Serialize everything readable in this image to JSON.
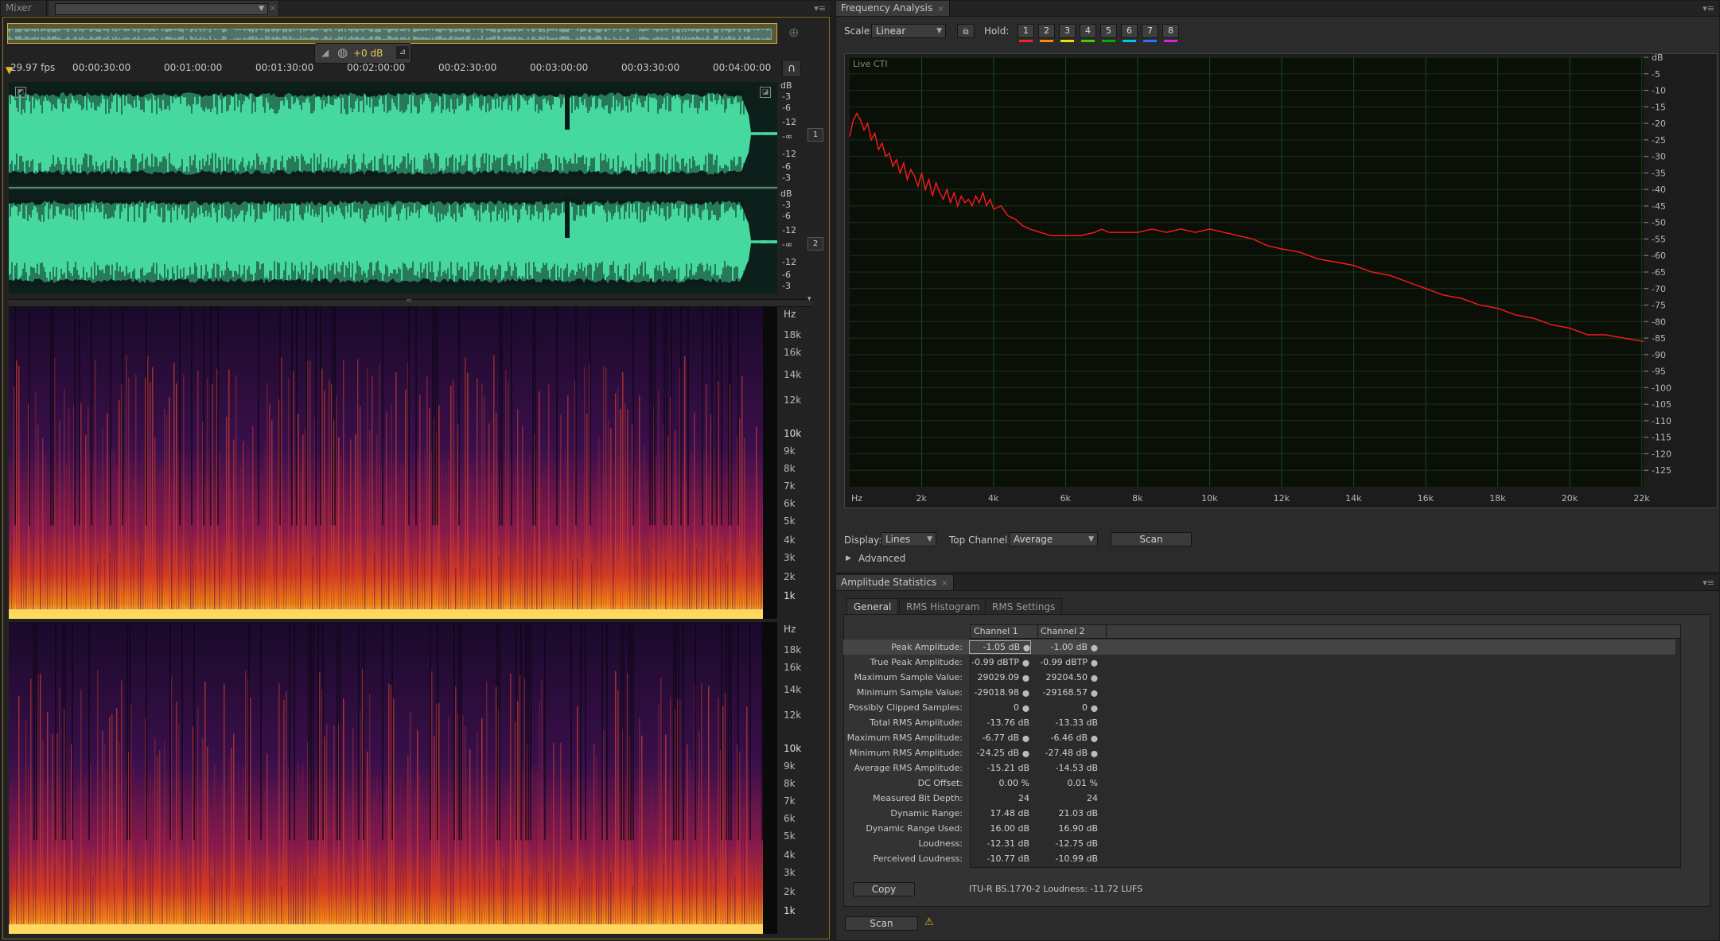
{
  "left_panel": {
    "tab_mixer": "Mixer",
    "transport": {
      "db_readout": "+0 dB"
    },
    "timeline": {
      "fps": "29.97 fps",
      "ticks": [
        "00:00:30:00",
        "00:01:00:00",
        "00:01:30:00",
        "00:02:00:00",
        "00:02:30:00",
        "00:03:00:00",
        "00:03:30:00",
        "00:04:00:00"
      ]
    },
    "waveform_scale": {
      "unit": "dB",
      "labels": [
        "-3",
        "-6",
        "-12",
        "-∞",
        "-12",
        "-6",
        "-3"
      ]
    },
    "channel_badges": [
      "1",
      "2"
    ],
    "spectral_scale": {
      "unit": "Hz",
      "labels": [
        "18k",
        "16k",
        "14k",
        "12k",
        "10k",
        "9k",
        "8k",
        "7k",
        "6k",
        "5k",
        "4k",
        "3k",
        "2k",
        "1k"
      ]
    }
  },
  "frequency_analysis": {
    "tab_title": "Frequency Analysis",
    "scale_label": "Scale:",
    "scale_value": "Linear",
    "hold_label": "Hold:",
    "hold_buttons": [
      {
        "label": "1",
        "color": "#ff2020"
      },
      {
        "label": "2",
        "color": "#ff8a00"
      },
      {
        "label": "3",
        "color": "#f0e000"
      },
      {
        "label": "4",
        "color": "#40d000"
      },
      {
        "label": "5",
        "color": "#00b000"
      },
      {
        "label": "6",
        "color": "#00c8e0"
      },
      {
        "label": "7",
        "color": "#3070ff"
      },
      {
        "label": "8",
        "color": "#e020e0"
      }
    ],
    "graph_caption": "Live CTI",
    "display_label": "Display:",
    "display_value": "Lines",
    "top_channel_label": "Top Channel:",
    "top_channel_value": "Average",
    "scan_label": "Scan",
    "advanced_label": "Advanced",
    "chart_data": {
      "type": "line",
      "xlabel": "Hz",
      "ylabel": "dB",
      "x_ticks": [
        "Hz",
        "2k",
        "4k",
        "6k",
        "8k",
        "10k",
        "12k",
        "14k",
        "16k",
        "18k",
        "20k",
        "22k"
      ],
      "y_ticks": [
        "dB",
        "-5",
        "-10",
        "-15",
        "-20",
        "-25",
        "-30",
        "-35",
        "-40",
        "-45",
        "-50",
        "-55",
        "-60",
        "-65",
        "-70",
        "-75",
        "-80",
        "-85",
        "-90",
        "-95",
        "-100",
        "-105",
        "-110",
        "-115",
        "-120",
        "-125"
      ],
      "xlim": [
        0,
        22050
      ],
      "ylim": [
        -130,
        0
      ],
      "grid": true,
      "series": [
        {
          "color": "#ff1a1a",
          "x": [
            0,
            100,
            200,
            300,
            400,
            500,
            600,
            700,
            800,
            900,
            1000,
            1100,
            1200,
            1300,
            1400,
            1500,
            1600,
            1700,
            1800,
            1900,
            2000,
            2100,
            2200,
            2300,
            2400,
            2500,
            2600,
            2700,
            2800,
            2900,
            3000,
            3100,
            3200,
            3300,
            3400,
            3500,
            3600,
            3700,
            3800,
            3900,
            4000,
            4200,
            4400,
            4600,
            4800,
            5000,
            5300,
            5600,
            6000,
            6400,
            6800,
            7000,
            7200,
            7600,
            8000,
            8400,
            8800,
            9200,
            9600,
            10000,
            10400,
            10800,
            11200,
            11600,
            12000,
            12500,
            13000,
            13500,
            14000,
            14500,
            15000,
            15500,
            16000,
            16500,
            17000,
            17500,
            18000,
            18500,
            19000,
            19500,
            20000,
            20500,
            21000,
            21500,
            22050
          ],
          "y": [
            -24,
            -19,
            -17,
            -19,
            -22,
            -20,
            -25,
            -23,
            -28,
            -26,
            -30,
            -29,
            -33,
            -31,
            -35,
            -32,
            -37,
            -34,
            -36,
            -39,
            -35,
            -40,
            -37,
            -42,
            -38,
            -41,
            -43,
            -40,
            -44,
            -41,
            -45,
            -42,
            -44,
            -43,
            -45,
            -42,
            -44,
            -41,
            -45,
            -43,
            -46,
            -45,
            -48,
            -49,
            -51,
            -52,
            -53,
            -54,
            -54,
            -54,
            -53,
            -52,
            -53,
            -53,
            -53,
            -52,
            -53,
            -52,
            -53,
            -52,
            -53,
            -54,
            -55,
            -57,
            -58,
            -59,
            -61,
            -62,
            -63,
            -65,
            -66,
            -68,
            -70,
            -72,
            -73,
            -75,
            -76,
            -78,
            -79,
            -81,
            -82,
            -84,
            -84,
            -85,
            -86
          ]
        }
      ]
    }
  },
  "amplitude_statistics": {
    "tab_title": "Amplitude Statistics",
    "tabs": [
      "General",
      "RMS Histogram",
      "RMS Settings"
    ],
    "columns": [
      "Channel 1",
      "Channel 2"
    ],
    "rows": [
      {
        "label": "Peak Amplitude:",
        "c1": "-1.05 dB",
        "c2": "-1.00 dB",
        "pin": true
      },
      {
        "label": "True Peak Amplitude:",
        "c1": "-0.99 dBTP",
        "c2": "-0.99 dBTP",
        "pin": true
      },
      {
        "label": "Maximum Sample Value:",
        "c1": "29029.09",
        "c2": "29204.50",
        "pin": true
      },
      {
        "label": "Minimum Sample Value:",
        "c1": "-29018.98",
        "c2": "-29168.57",
        "pin": true
      },
      {
        "label": "Possibly Clipped Samples:",
        "c1": "0",
        "c2": "0",
        "pin": true
      },
      {
        "label": "Total RMS Amplitude:",
        "c1": "-13.76 dB",
        "c2": "-13.33 dB",
        "pin": false
      },
      {
        "label": "Maximum RMS Amplitude:",
        "c1": "-6.77 dB",
        "c2": "-6.46 dB",
        "pin": true
      },
      {
        "label": "Minimum RMS Amplitude:",
        "c1": "-24.25 dB",
        "c2": "-27.48 dB",
        "pin": true
      },
      {
        "label": "Average RMS Amplitude:",
        "c1": "-15.21 dB",
        "c2": "-14.53 dB",
        "pin": false
      },
      {
        "label": "DC Offset:",
        "c1": "0.00 %",
        "c2": "0.01 %",
        "pin": false
      },
      {
        "label": "Measured Bit Depth:",
        "c1": "24",
        "c2": "24",
        "pin": false
      },
      {
        "label": "Dynamic Range:",
        "c1": "17.48 dB",
        "c2": "21.03 dB",
        "pin": false
      },
      {
        "label": "Dynamic Range Used:",
        "c1": "16.00 dB",
        "c2": "16.90 dB",
        "pin": false
      },
      {
        "label": "Loudness:",
        "c1": "-12.31 dB",
        "c2": "-12.75 dB",
        "pin": false
      },
      {
        "label": "Perceived Loudness:",
        "c1": "-10.77 dB",
        "c2": "-10.99 dB",
        "pin": false
      }
    ],
    "copy_label": "Copy",
    "loudness_line": "ITU-R BS.1770-2 Loudness: -11.72 LUFS",
    "scan_label": "Scan"
  }
}
